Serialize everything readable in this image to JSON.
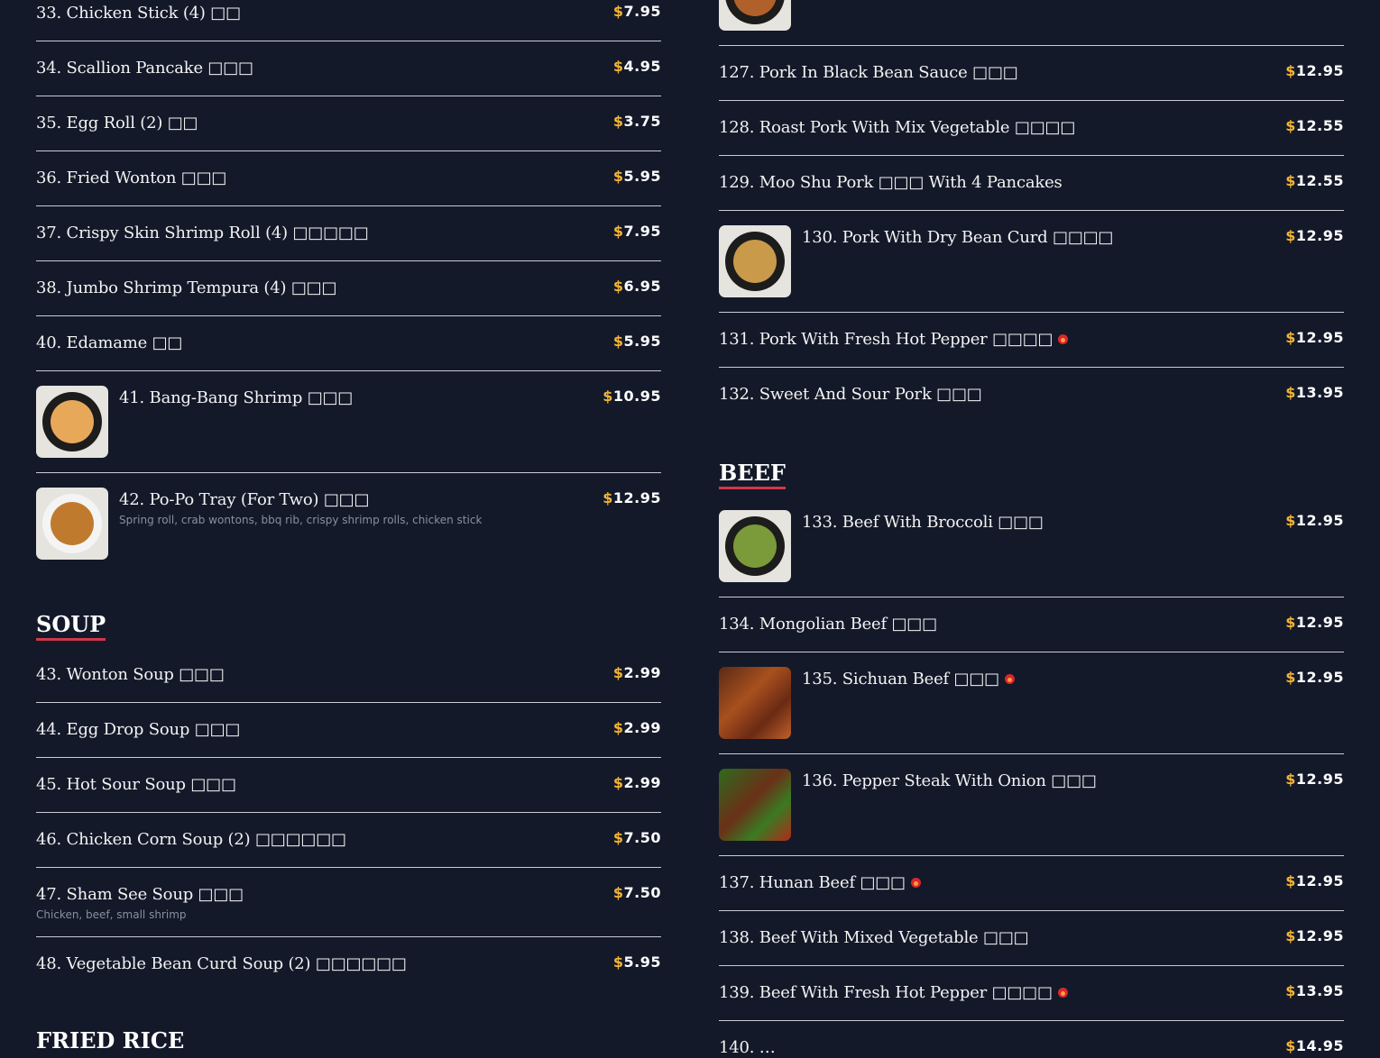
{
  "sections": {
    "soup": "SOUP",
    "beef": "BEEF",
    "fried_rice": "FRIED RICE"
  },
  "left": [
    {
      "name": "33. Chicken Stick (4) □□",
      "price": "7.95"
    },
    {
      "name": "34. Scallion Pancake □□□",
      "price": "4.95"
    },
    {
      "name": "35. Egg Roll (2) □□",
      "price": "3.75"
    },
    {
      "name": "36. Fried Wonton □□□",
      "price": "5.95"
    },
    {
      "name": "37. Crispy Skin Shrimp Roll (4) □□□□□",
      "price": "7.95"
    },
    {
      "name": "38. Jumbo Shrimp Tempura (4) □□□",
      "price": "6.95"
    },
    {
      "name": "40. Edamame □□",
      "price": "5.95"
    },
    {
      "name": "41. Bang-Bang Shrimp □□□",
      "price": "10.95"
    },
    {
      "name": "42. Po-Po Tray (For Two) □□□",
      "price": "12.95",
      "desc": "Spring roll, crab wontons, bbq rib, crispy shrimp rolls, chicken stick"
    },
    {
      "name": "43. Wonton Soup □□□",
      "price": "2.99"
    },
    {
      "name": "44. Egg Drop Soup □□□",
      "price": "2.99"
    },
    {
      "name": "45. Hot Sour Soup □□□",
      "price": "2.99"
    },
    {
      "name": "46. Chicken Corn Soup (2) □□□□□□",
      "price": "7.50"
    },
    {
      "name": "47. Sham See Soup □□□",
      "price": "7.50",
      "desc": "Chicken, beef, small shrimp"
    },
    {
      "name": "48. Vegetable Bean Curd Soup (2) □□□□□□",
      "price": "5.95"
    }
  ],
  "right": [
    {
      "name": "127. Pork In Black Bean Sauce □□□",
      "price": "12.95"
    },
    {
      "name": "128. Roast Pork With Mix Vegetable □□□□",
      "price": "12.55"
    },
    {
      "name": "129. Moo Shu Pork □□□ With 4 Pancakes",
      "price": "12.55"
    },
    {
      "name": "130. Pork With Dry Bean Curd □□□□",
      "price": "12.95"
    },
    {
      "name": "131. Pork With Fresh Hot Pepper □□□□",
      "price": "12.95"
    },
    {
      "name": "132. Sweet And Sour Pork □□□",
      "price": "13.95"
    },
    {
      "name": "133. Beef With Broccoli □□□",
      "price": "12.95"
    },
    {
      "name": "134. Mongolian Beef □□□",
      "price": "12.95"
    },
    {
      "name": "135. Sichuan Beef □□□",
      "price": "12.95"
    },
    {
      "name": "136. Pepper Steak With Onion □□□",
      "price": "12.95"
    },
    {
      "name": "137. Hunan Beef □□□",
      "price": "12.95"
    },
    {
      "name": "138. Beef With Mixed Vegetable □□□",
      "price": "12.95"
    },
    {
      "name": "139. Beef With Fresh Hot Pepper □□□□",
      "price": "13.95"
    },
    {
      "name": "140. …",
      "price": "14.95"
    }
  ],
  "currency": "$",
  "colors": {
    "background": "#131929",
    "accent": "#f2b437",
    "underline": "#d2374a",
    "spicy": "#d8282b"
  }
}
